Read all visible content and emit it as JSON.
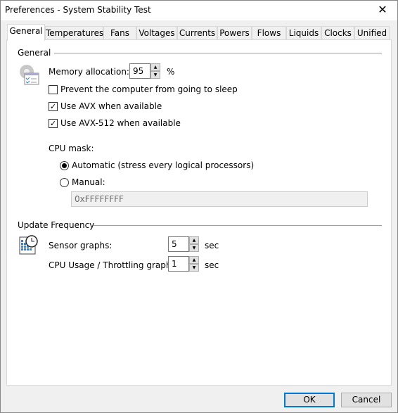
{
  "window": {
    "title": "Preferences - System Stability Test"
  },
  "tabs": [
    "General",
    "Temperatures",
    "Fans",
    "Voltages",
    "Currents",
    "Powers",
    "Flows",
    "Liquids",
    "Clocks",
    "Unified"
  ],
  "active_tab": "General",
  "general": {
    "group_label": "General",
    "memory_label": "Memory allocation:",
    "memory_value": "95",
    "memory_unit": "%",
    "prevent_sleep": {
      "label": "Prevent the computer from going to sleep",
      "checked": false
    },
    "use_avx": {
      "label": "Use AVX when available",
      "checked": true
    },
    "use_avx512": {
      "label": "Use AVX-512 when available",
      "checked": true
    },
    "cpu_mask_label": "CPU mask:",
    "automatic": {
      "label": "Automatic (stress every logical processors)",
      "selected": true
    },
    "manual": {
      "label": "Manual:",
      "selected": false
    },
    "mask_value": "0xFFFFFFFF"
  },
  "update": {
    "group_label": "Update Frequency",
    "sensor_label": "Sensor graphs:",
    "sensor_value": "5",
    "cpu_label": "CPU Usage / Throttling graph:",
    "cpu_value": "1",
    "unit": "sec"
  },
  "buttons": {
    "ok": "OK",
    "cancel": "Cancel"
  }
}
